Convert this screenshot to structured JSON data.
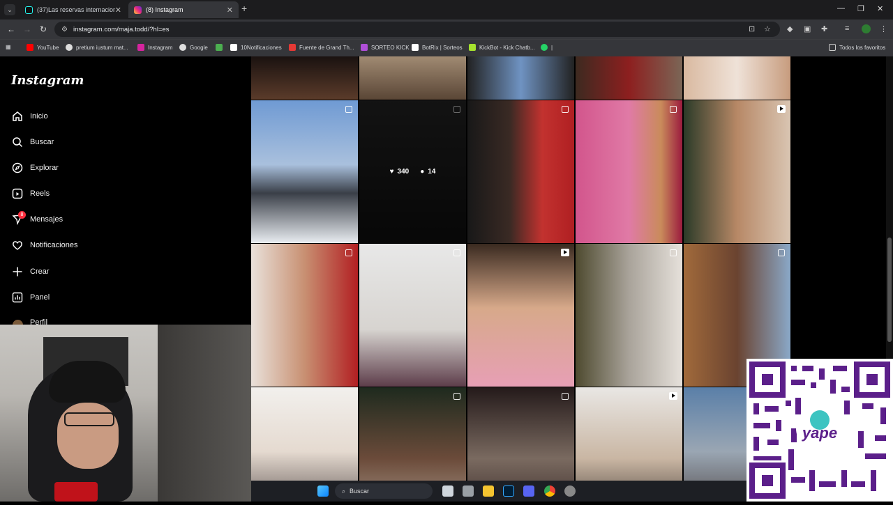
{
  "browser": {
    "tabs": [
      {
        "title": "(37)Las reservas internacionale",
        "active": false,
        "favicon": "tiktok-icon"
      },
      {
        "title": "(8) Instagram",
        "active": true,
        "favicon": "instagram-icon"
      }
    ],
    "url": "instagram.com/maja.todd/?hl=es",
    "bookmarks": [
      {
        "label": "YouTube",
        "icon": "youtube-icon",
        "color": "#ff0000"
      },
      {
        "label": "pretium iustum mat...",
        "icon": "google-icon",
        "color": "#dddddd"
      },
      {
        "label": "Instagram",
        "icon": "instagram-icon",
        "color": "#d6249f"
      },
      {
        "label": "Google",
        "icon": "google-icon",
        "color": "#dddddd"
      },
      {
        "label": "",
        "icon": "pinwheel-icon",
        "color": "#4caf50"
      },
      {
        "label": "10Notificaciones",
        "icon": "x-icon",
        "color": "#ffffff"
      },
      {
        "label": "Fuente de Grand Th...",
        "icon": "font-icon",
        "color": "#e53935"
      },
      {
        "label": "SORTEO KICK",
        "icon": "kick-icon",
        "color": "#b04fd8"
      },
      {
        "label": "BotRix | Sorteos",
        "icon": "botrix-icon",
        "color": "#ffffff"
      },
      {
        "label": "KickBot - Kick Chatb...",
        "icon": "kickbot-icon",
        "color": "#a6e22e"
      },
      {
        "label": "|",
        "icon": "whatsapp-icon",
        "color": "#25d366"
      }
    ],
    "all_bookmarks": "Todos los favoritos"
  },
  "instagram": {
    "logo": "Instagram",
    "nav": [
      {
        "label": "Inicio",
        "icon": "home-icon"
      },
      {
        "label": "Buscar",
        "icon": "search-icon"
      },
      {
        "label": "Explorar",
        "icon": "compass-icon"
      },
      {
        "label": "Reels",
        "icon": "reels-icon"
      },
      {
        "label": "Mensajes",
        "icon": "messenger-icon"
      },
      {
        "label": "Notificaciones",
        "icon": "heart-icon"
      },
      {
        "label": "Crear",
        "icon": "plus-icon"
      },
      {
        "label": "Panel",
        "icon": "panel-icon"
      },
      {
        "label": "Perfil",
        "icon": "avatar-icon"
      }
    ],
    "messages_badge": "8",
    "hovered_post": {
      "likes": "340",
      "comments": "14"
    }
  },
  "taskbar": {
    "search": "Buscar"
  },
  "colors": {
    "accent": "#ff3040",
    "qr": "#5b1f8a"
  }
}
